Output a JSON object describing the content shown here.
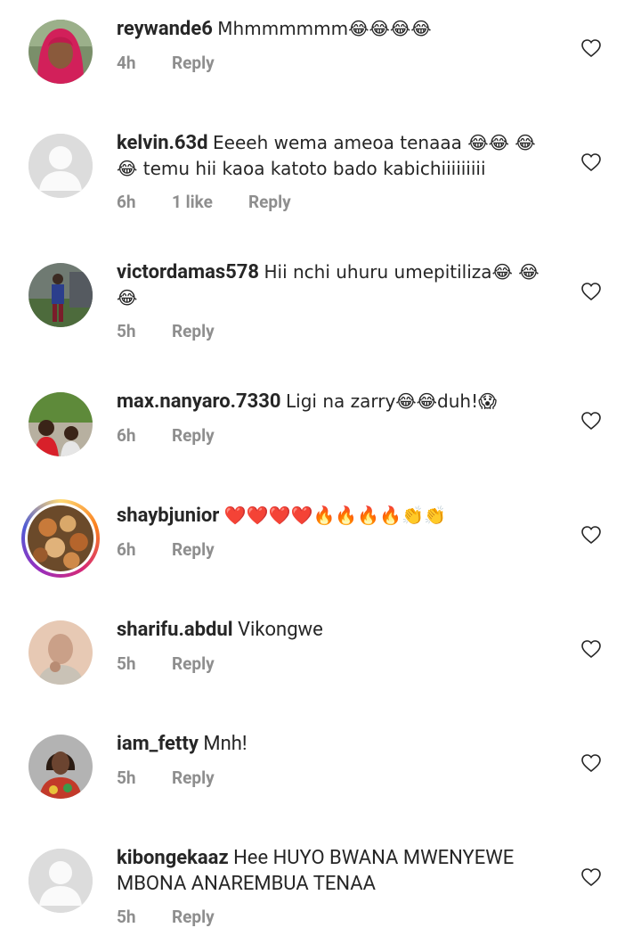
{
  "comments": [
    {
      "username": "reywande6",
      "text": "Mhmmmmmm😂😂😂😂",
      "time": "4h",
      "likes": "",
      "reply": "Reply"
    },
    {
      "username": "kelvin.63d",
      "text": "Eeeeh wema ameoa tenaaa 😂😂 😂😂 temu hii kaoa katoto bado  kabichiiiiiiiii",
      "time": "6h",
      "likes": "1 like",
      "reply": "Reply"
    },
    {
      "username": "victordamas578",
      "text": "Hii nchi uhuru umepitiliza😂 😂😂",
      "time": "5h",
      "likes": "",
      "reply": "Reply"
    },
    {
      "username": "max.nanyaro.7330",
      "text": "Ligi na zarry😂😂duh!😱",
      "time": "6h",
      "likes": "",
      "reply": "Reply"
    },
    {
      "username": "shaybjunior",
      "text": "❤️❤️❤️❤️🔥🔥🔥🔥👏👏",
      "time": "6h",
      "likes": "",
      "reply": "Reply"
    },
    {
      "username": "sharifu.abdul",
      "text": "Vikongwe",
      "time": "5h",
      "likes": "",
      "reply": "Reply"
    },
    {
      "username": "iam_fetty",
      "text": "Mnh!",
      "time": "5h",
      "likes": "",
      "reply": "Reply"
    },
    {
      "username": "kibongekaaz",
      "text": "Hee HUYO BWANA MWENYEWE MBONA ANAREMBUA TENAA",
      "time": "5h",
      "likes": "",
      "reply": "Reply"
    }
  ],
  "colors": {
    "text": "#262626",
    "secondary": "#8e8e8e",
    "background": "#ffffff"
  },
  "icons": {
    "like": "heart-outline-icon"
  }
}
